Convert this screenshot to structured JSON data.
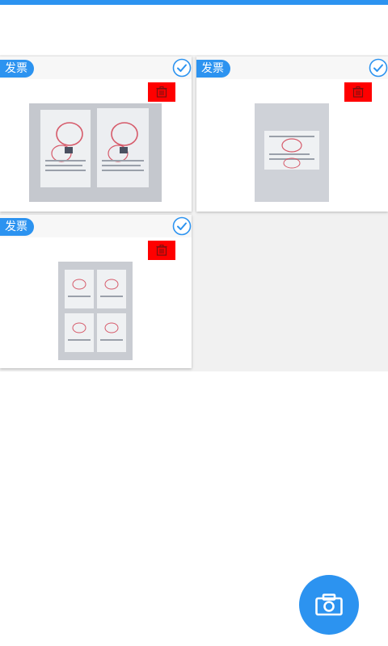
{
  "colors": {
    "accent": "#2c93f0",
    "delete_red": "#ff0000",
    "grid_background": "#f1f1f1"
  },
  "cards": [
    {
      "badge": "发票",
      "checked": true,
      "delete_icon": "trash-icon",
      "thumbnail": "photo-of-two-invoices"
    },
    {
      "badge": "发票",
      "checked": true,
      "delete_icon": "trash-icon",
      "thumbnail": "photo-of-one-invoice"
    },
    {
      "badge": "发票",
      "checked": true,
      "delete_icon": "trash-icon",
      "thumbnail": "photo-of-four-invoices"
    }
  ],
  "fab": {
    "icon": "camera-icon"
  }
}
